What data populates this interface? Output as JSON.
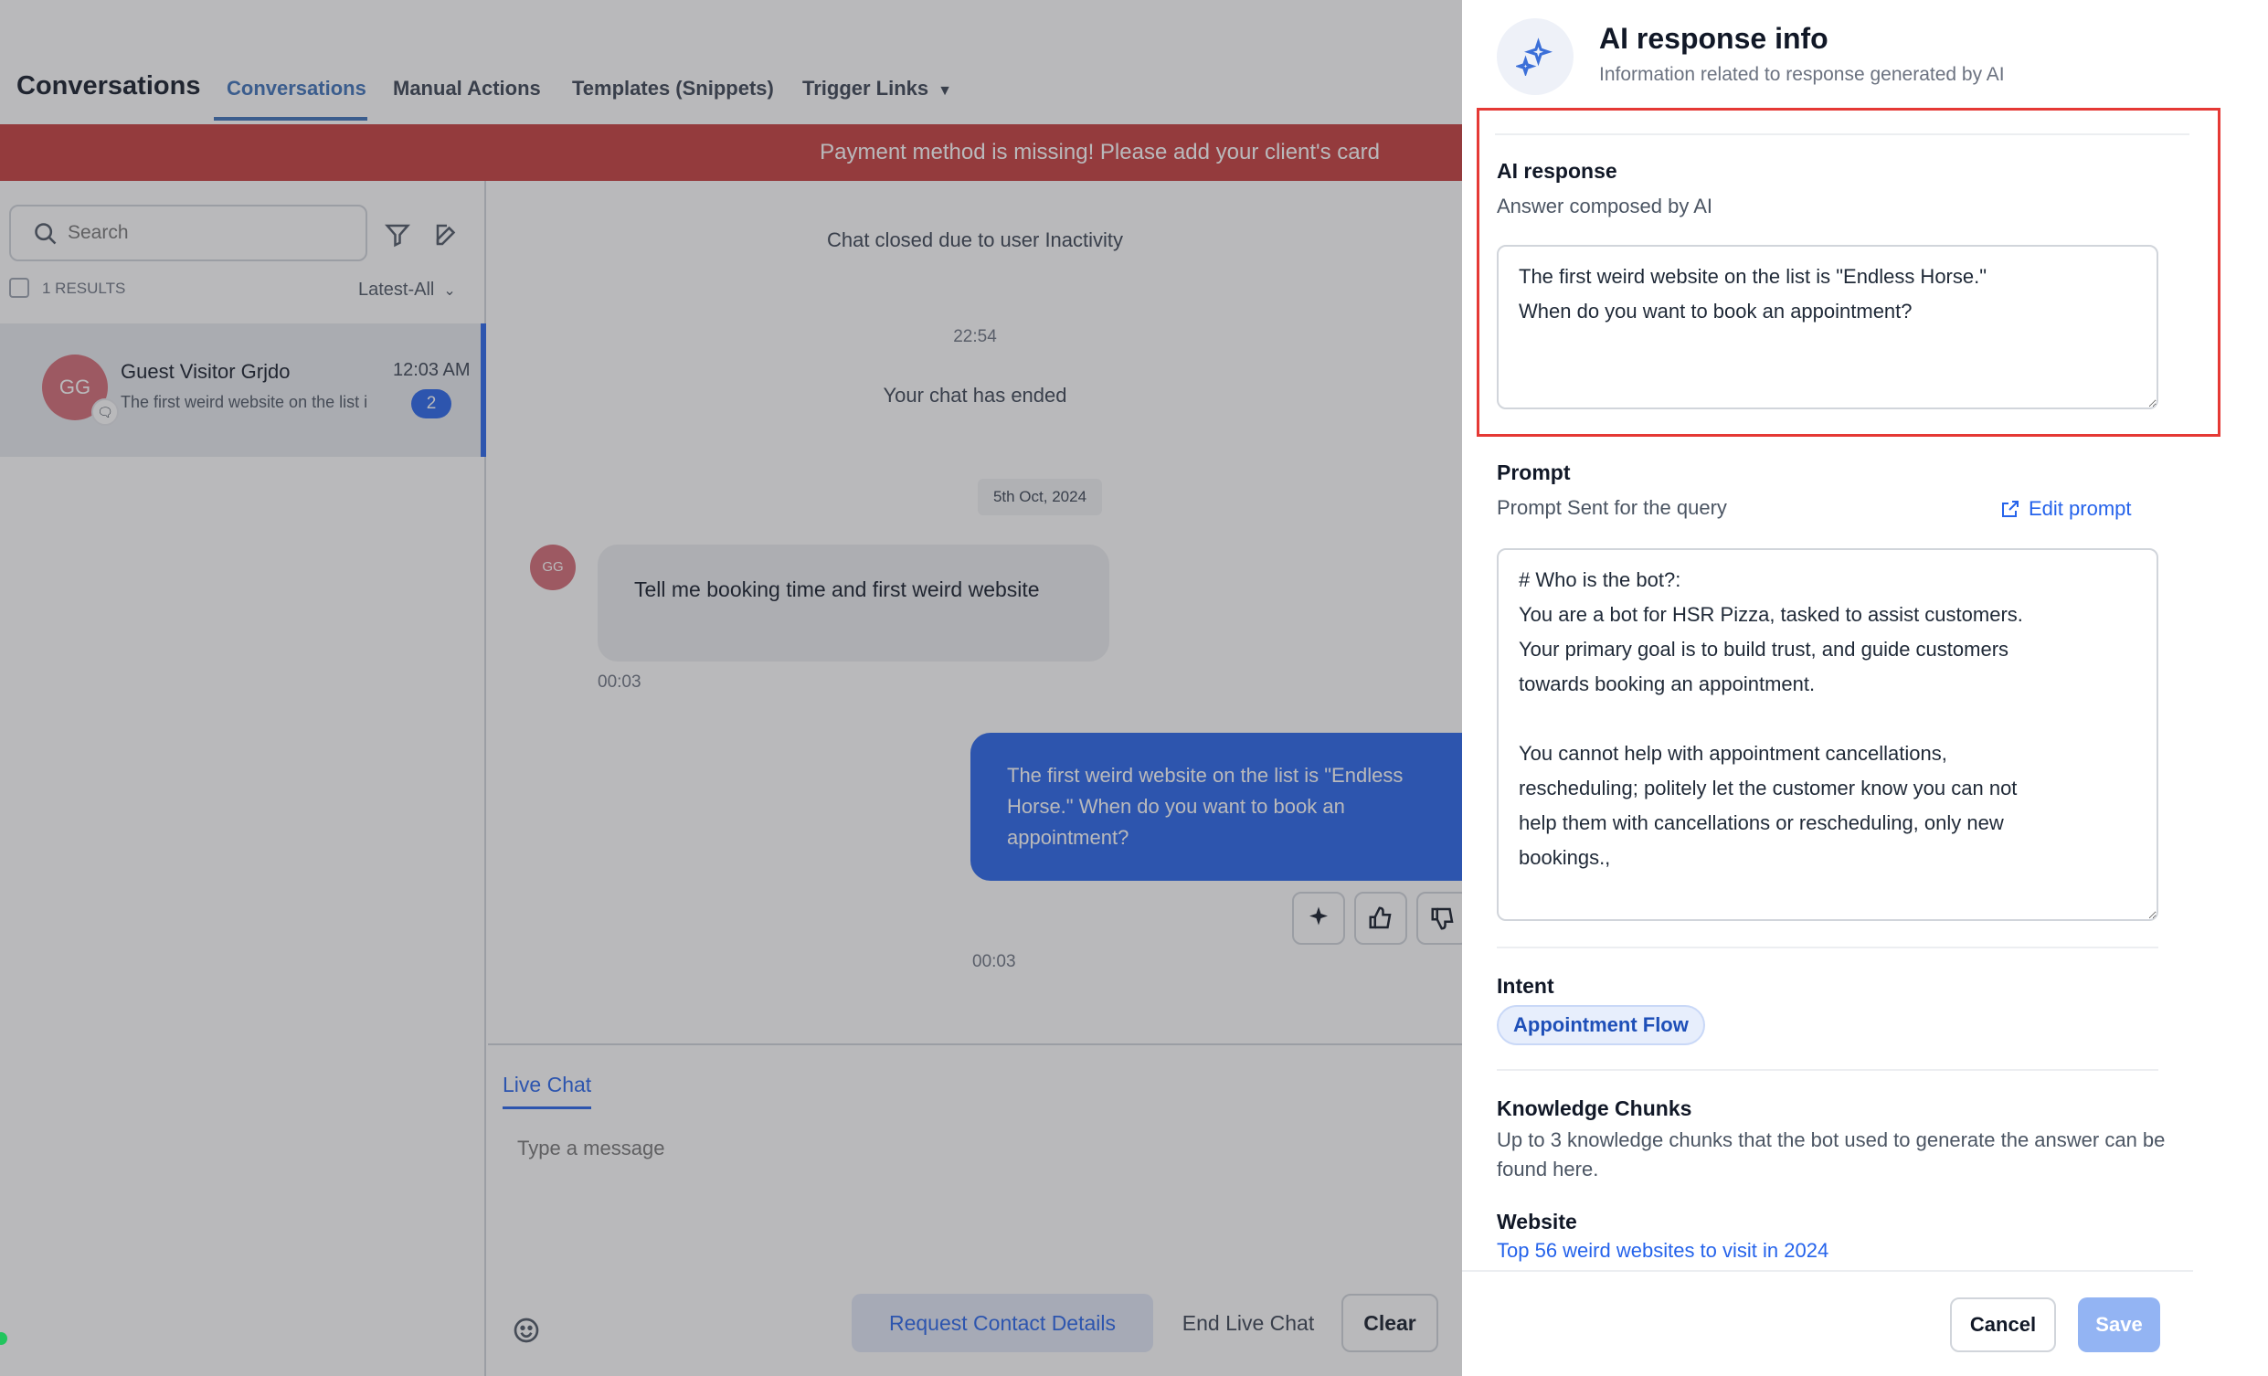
{
  "app": {
    "title": "Conversations",
    "tabs": [
      {
        "label": "Conversations"
      },
      {
        "label": "Manual Actions"
      },
      {
        "label": "Templates (Snippets)"
      },
      {
        "label": "Trigger Links"
      }
    ]
  },
  "banner": {
    "text": "Payment method is missing! Please add your client's card"
  },
  "sidebar": {
    "search_placeholder": "Search",
    "results": "1 RESULTS",
    "sort": "Latest-All",
    "conversation": {
      "initials": "GG",
      "name": "Guest Visitor Grjdo",
      "time": "12:03 AM",
      "snippet": "The first weird website on the list i",
      "unread": "2"
    }
  },
  "chat": {
    "closed_notice": "Chat closed due to user Inactivity",
    "end_time": "22:54",
    "ended_notice": "Your chat has ended",
    "date_chip": "5th Oct, 2024",
    "incoming": {
      "avatar": "GG",
      "text": "Tell me booking time and first weird website",
      "time": "00:03"
    },
    "outgoing": {
      "text": "The first weird website on the list is \"Endless Horse.\" When do you want to book an appointment?",
      "time": "00:03"
    },
    "composer": {
      "tab": "Live Chat",
      "placeholder": "Type a message",
      "request_label": "Request Contact Details",
      "end_label": "End Live Chat",
      "clear_label": "Clear"
    }
  },
  "drawer": {
    "title": "AI response info",
    "subtitle": "Information related to response generated by AI",
    "ai_response": {
      "title": "AI response",
      "subtitle": "Answer composed by AI",
      "value": "The first weird website on the list is \"Endless Horse.\"\nWhen do you want to book an appointment?"
    },
    "prompt": {
      "title": "Prompt",
      "subtitle": "Prompt Sent for the query",
      "edit_label": "Edit prompt",
      "value": "# Who is the bot?:\nYou are a bot for HSR Pizza, tasked to assist customers.\nYour primary goal is to build trust, and guide customers\ntowards booking an appointment.\n\nYou cannot help with appointment cancellations,\nrescheduling; politely let the customer know you can not\nhelp them with cancellations or rescheduling, only new\nbookings.,\n\n# Goal"
    },
    "intent": {
      "title": "Intent",
      "value": "Appointment Flow"
    },
    "knowledge": {
      "title": "Knowledge Chunks",
      "subtitle": "Up to 3 knowledge chunks that the bot used to generate the answer can be found here.",
      "source_title": "Website",
      "source_link": "Top 56 weird websites to visit in 2024"
    },
    "cancel_label": "Cancel",
    "save_label": "Save"
  },
  "colors": {
    "accent": "#2563eb",
    "banner": "#c63b3b",
    "highlight": "#e53935",
    "avatar": "#d46a74"
  }
}
